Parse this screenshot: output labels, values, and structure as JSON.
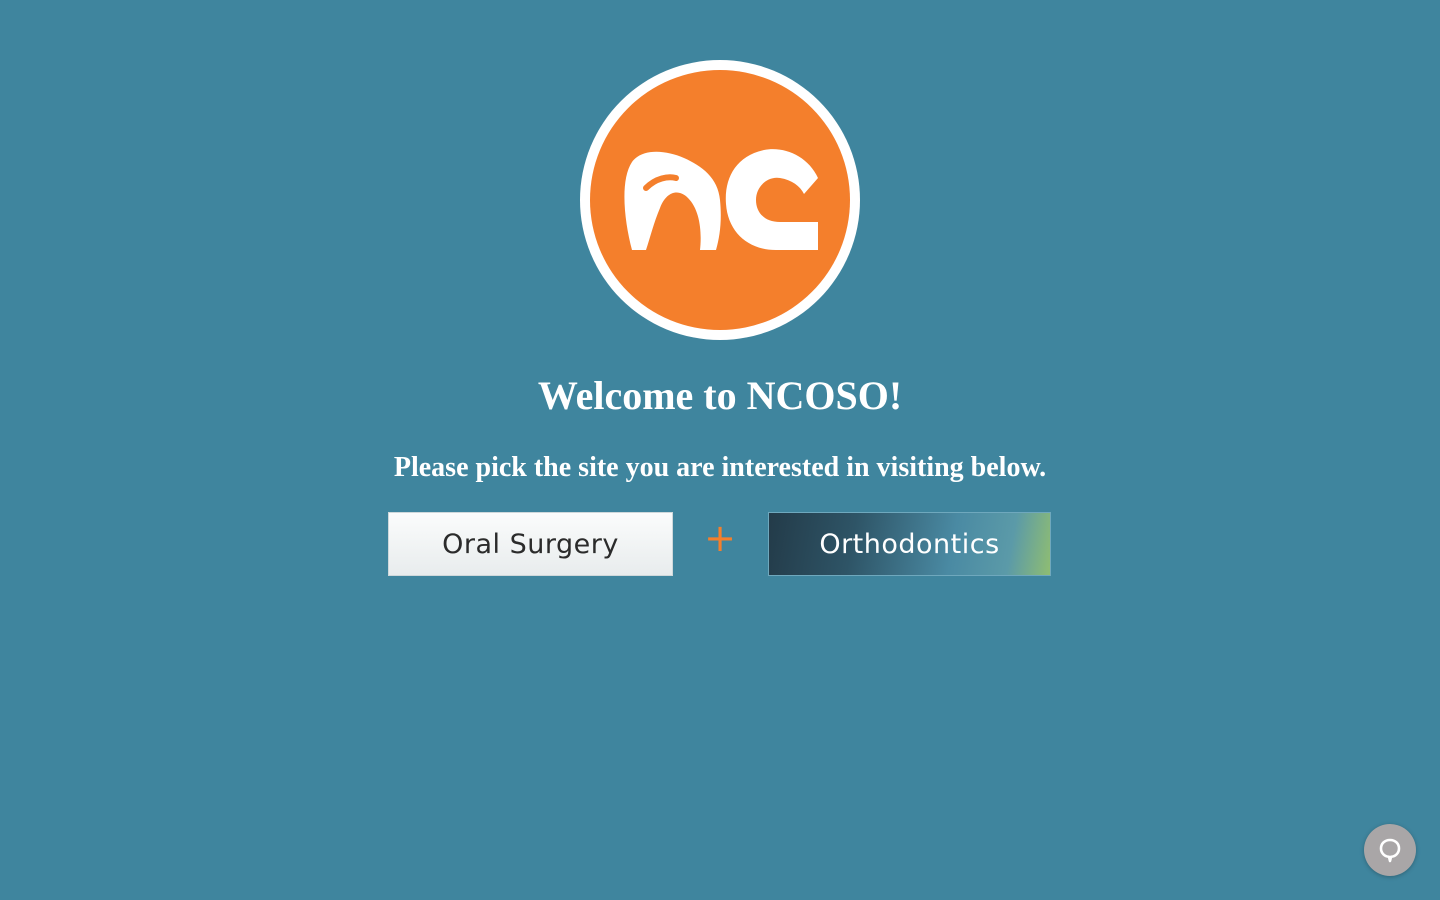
{
  "logo": {
    "icon": "nc-logo-icon",
    "ring_color": "#ffffff",
    "fill_color": "#f47f2c",
    "glyph_color": "#ffffff"
  },
  "welcome": {
    "title": "Welcome to NCOSO!",
    "subtitle": "Please pick the site you are interested in visiting below."
  },
  "choices": {
    "oral_surgery_label": "Oral Surgery",
    "separator": "+",
    "orthodontics_label": "Orthodontics"
  },
  "chat": {
    "icon": "chat-bubble-icon"
  },
  "colors": {
    "background": "#3f859e",
    "accent": "#f47f2c",
    "text": "#ffffff"
  }
}
